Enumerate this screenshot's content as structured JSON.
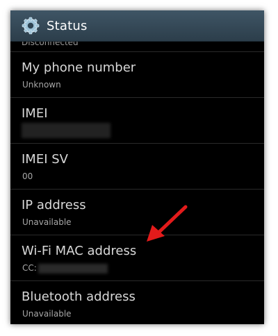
{
  "header": {
    "title": "Status"
  },
  "list": {
    "partial_value": "Disconnected",
    "items": [
      {
        "label": "My phone number",
        "value": "Unknown"
      },
      {
        "label": "IMEI",
        "value": ""
      },
      {
        "label": "IMEI SV",
        "value": "00"
      },
      {
        "label": "IP address",
        "value": "Unavailable"
      },
      {
        "label": "Wi-Fi MAC address",
        "value": "CC:"
      },
      {
        "label": "Bluetooth address",
        "value": "Unavailable"
      }
    ]
  },
  "colors": {
    "action_bar": "#34495a",
    "background": "#000000",
    "label_text": "#d8d8d8",
    "value_text": "#a8a8a8",
    "arrow": "#e31b1b"
  },
  "icons": {
    "header": "gear-icon",
    "annotation": "red-arrow-icon"
  }
}
